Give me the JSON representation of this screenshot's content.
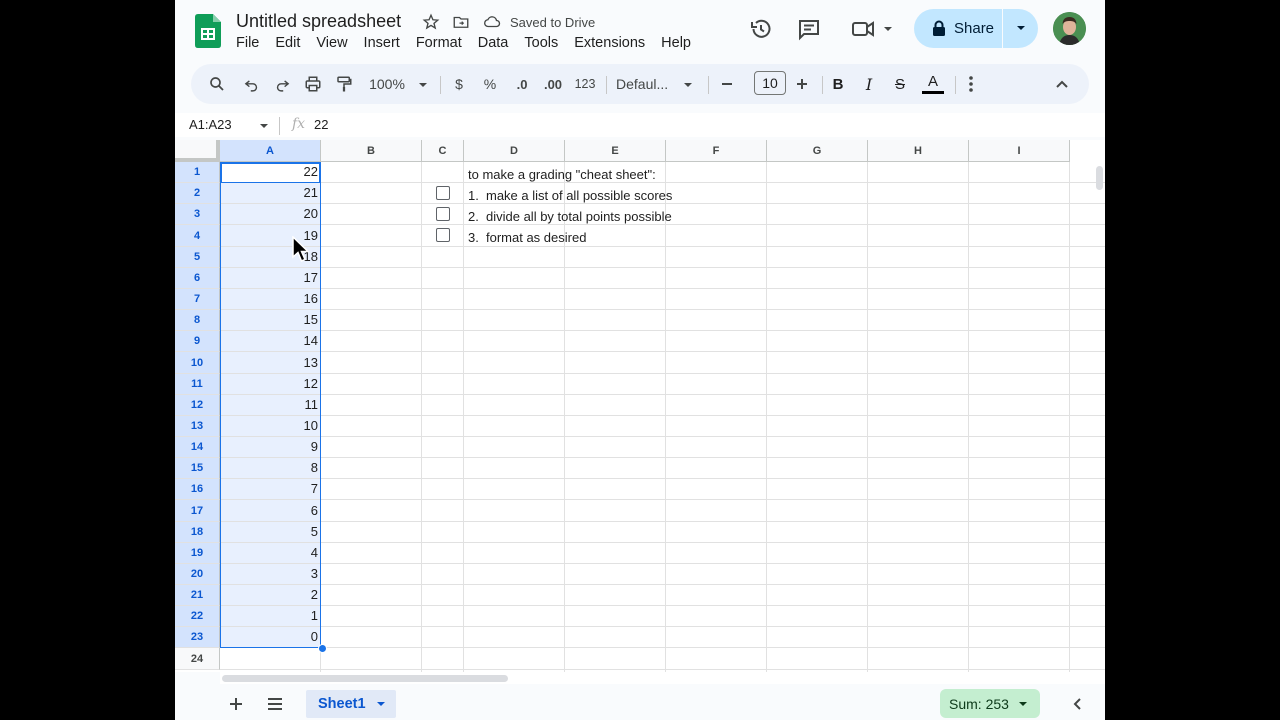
{
  "app": {
    "title": "Untitled spreadsheet",
    "saved_status": "Saved to Drive",
    "share_label": "Share",
    "menu": [
      "File",
      "Edit",
      "View",
      "Insert",
      "Format",
      "Data",
      "Tools",
      "Extensions",
      "Help"
    ]
  },
  "toolbar": {
    "zoom": "100%",
    "currency": "$",
    "percent": "%",
    "dec_decrease": ".0",
    "dec_increase": ".00",
    "number_format": "123",
    "font": "Defaul...",
    "font_size": "10",
    "bold": "B",
    "italic": "I",
    "strike": "S",
    "text_color": "A"
  },
  "formula_bar": {
    "name_box": "A1:A23",
    "fx": "fx",
    "value": "22"
  },
  "columns": [
    "A",
    "B",
    "C",
    "D",
    "E",
    "F",
    "G",
    "H",
    "I"
  ],
  "rows": [
    "1",
    "2",
    "3",
    "4",
    "5",
    "6",
    "7",
    "8",
    "9",
    "10",
    "11",
    "12",
    "13",
    "14",
    "15",
    "16",
    "17",
    "18",
    "19",
    "20",
    "21",
    "22",
    "23",
    "24"
  ],
  "col_a_values": [
    "22",
    "21",
    "20",
    "19",
    "18",
    "17",
    "16",
    "15",
    "14",
    "13",
    "12",
    "11",
    "10",
    "9",
    "8",
    "7",
    "6",
    "5",
    "4",
    "3",
    "2",
    "1",
    "0"
  ],
  "notes": {
    "heading": "to make a grading \"cheat sheet\":",
    "steps": [
      {
        "num": "1.",
        "text": "make a list of all possible scores"
      },
      {
        "num": "2.",
        "text": "divide all by total points possible"
      },
      {
        "num": "3.",
        "text": "format as desired"
      }
    ]
  },
  "bottom": {
    "sheet_name": "Sheet1",
    "sum": "Sum: 253"
  },
  "colors": {
    "accent": "#0b57d0",
    "selection": "#e8f0fe",
    "share_bg": "#c2e7ff",
    "sum_bg": "#c4eed0"
  }
}
